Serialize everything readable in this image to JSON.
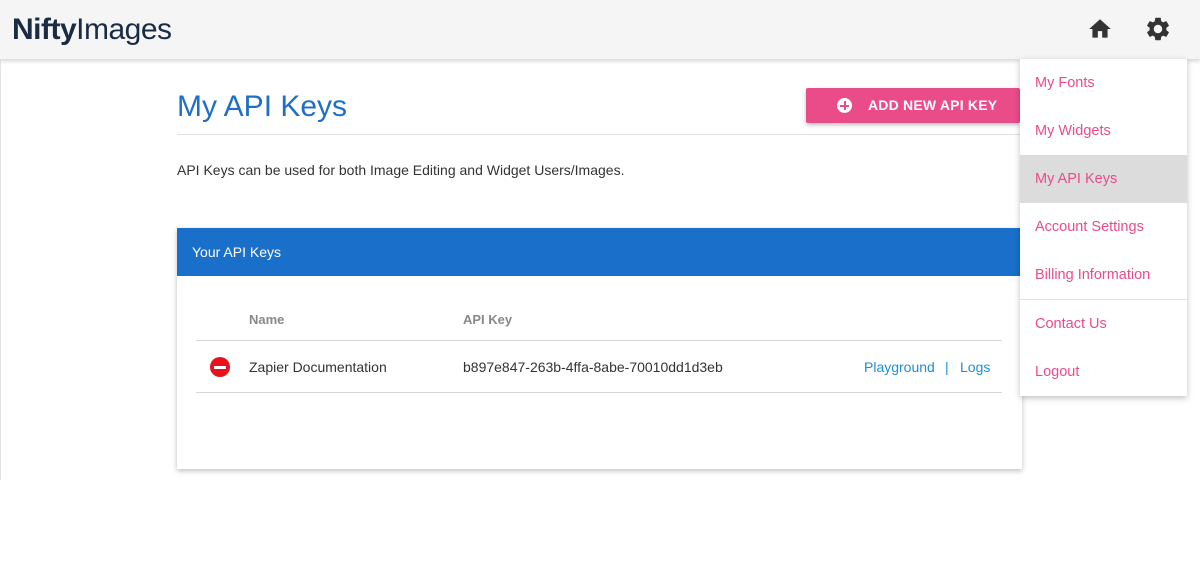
{
  "header": {
    "logo_bold": "Nifty",
    "logo_light": "Images"
  },
  "page": {
    "title": "My API Keys",
    "add_button_label": "ADD NEW API KEY",
    "description": "API Keys can be used for both Image Editing and Widget Users/Images."
  },
  "card": {
    "title": "Your API Keys",
    "columns": [
      "Name",
      "API Key"
    ],
    "rows": [
      {
        "name": "Zapier Documentation",
        "api_key": "b897e847-263b-4ffa-8abe-70010dd1d3eb",
        "link_playground": "Playground",
        "separator": "|",
        "link_logs": "Logs"
      }
    ]
  },
  "menu": {
    "items": [
      {
        "label": "My Fonts"
      },
      {
        "label": "My Widgets"
      },
      {
        "label": "My API Keys",
        "active": true
      },
      {
        "label": "Account Settings"
      },
      {
        "label": "Billing Information"
      },
      {
        "label": "Contact Us"
      },
      {
        "label": "Logout"
      }
    ]
  },
  "icons": {
    "home": "home-icon",
    "settings": "gear-icon",
    "add": "plus-circle-icon",
    "delete": "minus-circle-icon"
  },
  "colors": {
    "brand_blue": "#1f6fc6",
    "header_blue": "#1a6fcb",
    "accent_pink": "#ea4c89",
    "delete_red": "#e8121d",
    "link_blue": "#1f8fd6"
  }
}
